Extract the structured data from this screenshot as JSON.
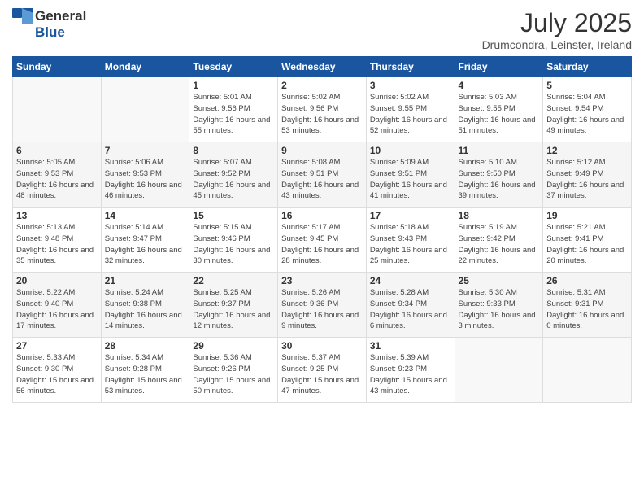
{
  "logo": {
    "general": "General",
    "blue": "Blue"
  },
  "title": "July 2025",
  "location": "Drumcondra, Leinster, Ireland",
  "days_header": [
    "Sunday",
    "Monday",
    "Tuesday",
    "Wednesday",
    "Thursday",
    "Friday",
    "Saturday"
  ],
  "weeks": [
    {
      "days": [
        {
          "num": "",
          "detail": ""
        },
        {
          "num": "",
          "detail": ""
        },
        {
          "num": "1",
          "detail": "Sunrise: 5:01 AM\nSunset: 9:56 PM\nDaylight: 16 hours\nand 55 minutes."
        },
        {
          "num": "2",
          "detail": "Sunrise: 5:02 AM\nSunset: 9:56 PM\nDaylight: 16 hours\nand 53 minutes."
        },
        {
          "num": "3",
          "detail": "Sunrise: 5:02 AM\nSunset: 9:55 PM\nDaylight: 16 hours\nand 52 minutes."
        },
        {
          "num": "4",
          "detail": "Sunrise: 5:03 AM\nSunset: 9:55 PM\nDaylight: 16 hours\nand 51 minutes."
        },
        {
          "num": "5",
          "detail": "Sunrise: 5:04 AM\nSunset: 9:54 PM\nDaylight: 16 hours\nand 49 minutes."
        }
      ]
    },
    {
      "days": [
        {
          "num": "6",
          "detail": "Sunrise: 5:05 AM\nSunset: 9:53 PM\nDaylight: 16 hours\nand 48 minutes."
        },
        {
          "num": "7",
          "detail": "Sunrise: 5:06 AM\nSunset: 9:53 PM\nDaylight: 16 hours\nand 46 minutes."
        },
        {
          "num": "8",
          "detail": "Sunrise: 5:07 AM\nSunset: 9:52 PM\nDaylight: 16 hours\nand 45 minutes."
        },
        {
          "num": "9",
          "detail": "Sunrise: 5:08 AM\nSunset: 9:51 PM\nDaylight: 16 hours\nand 43 minutes."
        },
        {
          "num": "10",
          "detail": "Sunrise: 5:09 AM\nSunset: 9:51 PM\nDaylight: 16 hours\nand 41 minutes."
        },
        {
          "num": "11",
          "detail": "Sunrise: 5:10 AM\nSunset: 9:50 PM\nDaylight: 16 hours\nand 39 minutes."
        },
        {
          "num": "12",
          "detail": "Sunrise: 5:12 AM\nSunset: 9:49 PM\nDaylight: 16 hours\nand 37 minutes."
        }
      ]
    },
    {
      "days": [
        {
          "num": "13",
          "detail": "Sunrise: 5:13 AM\nSunset: 9:48 PM\nDaylight: 16 hours\nand 35 minutes."
        },
        {
          "num": "14",
          "detail": "Sunrise: 5:14 AM\nSunset: 9:47 PM\nDaylight: 16 hours\nand 32 minutes."
        },
        {
          "num": "15",
          "detail": "Sunrise: 5:15 AM\nSunset: 9:46 PM\nDaylight: 16 hours\nand 30 minutes."
        },
        {
          "num": "16",
          "detail": "Sunrise: 5:17 AM\nSunset: 9:45 PM\nDaylight: 16 hours\nand 28 minutes."
        },
        {
          "num": "17",
          "detail": "Sunrise: 5:18 AM\nSunset: 9:43 PM\nDaylight: 16 hours\nand 25 minutes."
        },
        {
          "num": "18",
          "detail": "Sunrise: 5:19 AM\nSunset: 9:42 PM\nDaylight: 16 hours\nand 22 minutes."
        },
        {
          "num": "19",
          "detail": "Sunrise: 5:21 AM\nSunset: 9:41 PM\nDaylight: 16 hours\nand 20 minutes."
        }
      ]
    },
    {
      "days": [
        {
          "num": "20",
          "detail": "Sunrise: 5:22 AM\nSunset: 9:40 PM\nDaylight: 16 hours\nand 17 minutes."
        },
        {
          "num": "21",
          "detail": "Sunrise: 5:24 AM\nSunset: 9:38 PM\nDaylight: 16 hours\nand 14 minutes."
        },
        {
          "num": "22",
          "detail": "Sunrise: 5:25 AM\nSunset: 9:37 PM\nDaylight: 16 hours\nand 12 minutes."
        },
        {
          "num": "23",
          "detail": "Sunrise: 5:26 AM\nSunset: 9:36 PM\nDaylight: 16 hours\nand 9 minutes."
        },
        {
          "num": "24",
          "detail": "Sunrise: 5:28 AM\nSunset: 9:34 PM\nDaylight: 16 hours\nand 6 minutes."
        },
        {
          "num": "25",
          "detail": "Sunrise: 5:30 AM\nSunset: 9:33 PM\nDaylight: 16 hours\nand 3 minutes."
        },
        {
          "num": "26",
          "detail": "Sunrise: 5:31 AM\nSunset: 9:31 PM\nDaylight: 16 hours\nand 0 minutes."
        }
      ]
    },
    {
      "days": [
        {
          "num": "27",
          "detail": "Sunrise: 5:33 AM\nSunset: 9:30 PM\nDaylight: 15 hours\nand 56 minutes."
        },
        {
          "num": "28",
          "detail": "Sunrise: 5:34 AM\nSunset: 9:28 PM\nDaylight: 15 hours\nand 53 minutes."
        },
        {
          "num": "29",
          "detail": "Sunrise: 5:36 AM\nSunset: 9:26 PM\nDaylight: 15 hours\nand 50 minutes."
        },
        {
          "num": "30",
          "detail": "Sunrise: 5:37 AM\nSunset: 9:25 PM\nDaylight: 15 hours\nand 47 minutes."
        },
        {
          "num": "31",
          "detail": "Sunrise: 5:39 AM\nSunset: 9:23 PM\nDaylight: 15 hours\nand 43 minutes."
        },
        {
          "num": "",
          "detail": ""
        },
        {
          "num": "",
          "detail": ""
        }
      ]
    }
  ]
}
